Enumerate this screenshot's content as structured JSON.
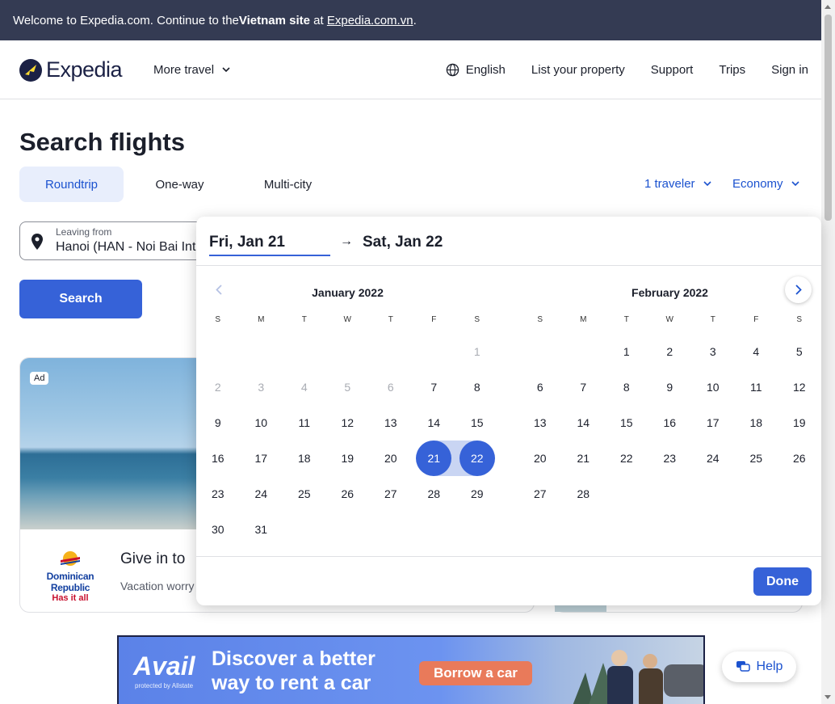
{
  "banner": {
    "prefix": "Welcome to Expedia.com. Continue to the ",
    "bold": "Vietnam site",
    "middle": " at ",
    "link": "Expedia.com.vn",
    "suffix": "."
  },
  "header": {
    "logo": "Expedia",
    "more_travel": "More travel",
    "language": "English",
    "list_property": "List your property",
    "support": "Support",
    "trips": "Trips",
    "sign_in": "Sign in"
  },
  "page": {
    "title": "Search flights"
  },
  "tabs": [
    {
      "label": "Roundtrip",
      "active": true
    },
    {
      "label": "One-way",
      "active": false
    },
    {
      "label": "Multi-city",
      "active": false
    }
  ],
  "travelers": "1 traveler",
  "cabin": "Economy",
  "leaving": {
    "label": "Leaving from",
    "value": "Hanoi (HAN - Noi Bai International)"
  },
  "search_button": "Search",
  "ad": {
    "badge": "Ad",
    "logo_name": "Dominican Republic",
    "logo_tag": "Has it all",
    "title": "Give in to",
    "subtitle": "Vacation worry"
  },
  "datepicker": {
    "from": "Fri, Jan 21",
    "arrow": "→",
    "to": "Sat, Jan 22",
    "weekdays": [
      "S",
      "M",
      "T",
      "W",
      "T",
      "F",
      "S"
    ],
    "months": [
      {
        "title": "January 2022",
        "days": [
          "",
          "",
          "",
          "",
          "",
          "",
          "1",
          "2",
          "3",
          "4",
          "5",
          "6",
          "7",
          "8",
          "9",
          "10",
          "11",
          "12",
          "13",
          "14",
          "15",
          "16",
          "17",
          "18",
          "19",
          "20",
          "21",
          "22",
          "23",
          "24",
          "25",
          "26",
          "27",
          "28",
          "29",
          "30",
          "31"
        ],
        "muted": [
          "1",
          "2",
          "3",
          "4",
          "5",
          "6"
        ]
      },
      {
        "title": "February 2022",
        "days": [
          "",
          "",
          "1",
          "2",
          "3",
          "4",
          "5",
          "6",
          "7",
          "8",
          "9",
          "10",
          "11",
          "12",
          "13",
          "14",
          "15",
          "16",
          "17",
          "18",
          "19",
          "20",
          "21",
          "22",
          "23",
          "24",
          "25",
          "26",
          "27",
          "28"
        ],
        "muted": []
      }
    ],
    "selected_start": "21",
    "selected_end": "22",
    "done": "Done"
  },
  "car_ad": {
    "brand": "Avail",
    "brand_sub": "protected by Allstate",
    "headline_1": "Discover a better",
    "headline_2": "way to rent a car",
    "cta": "Borrow a car"
  },
  "help": "Help",
  "colors": {
    "primary": "#3662d8",
    "banner": "#343b53",
    "range": "#c9d5f3"
  }
}
